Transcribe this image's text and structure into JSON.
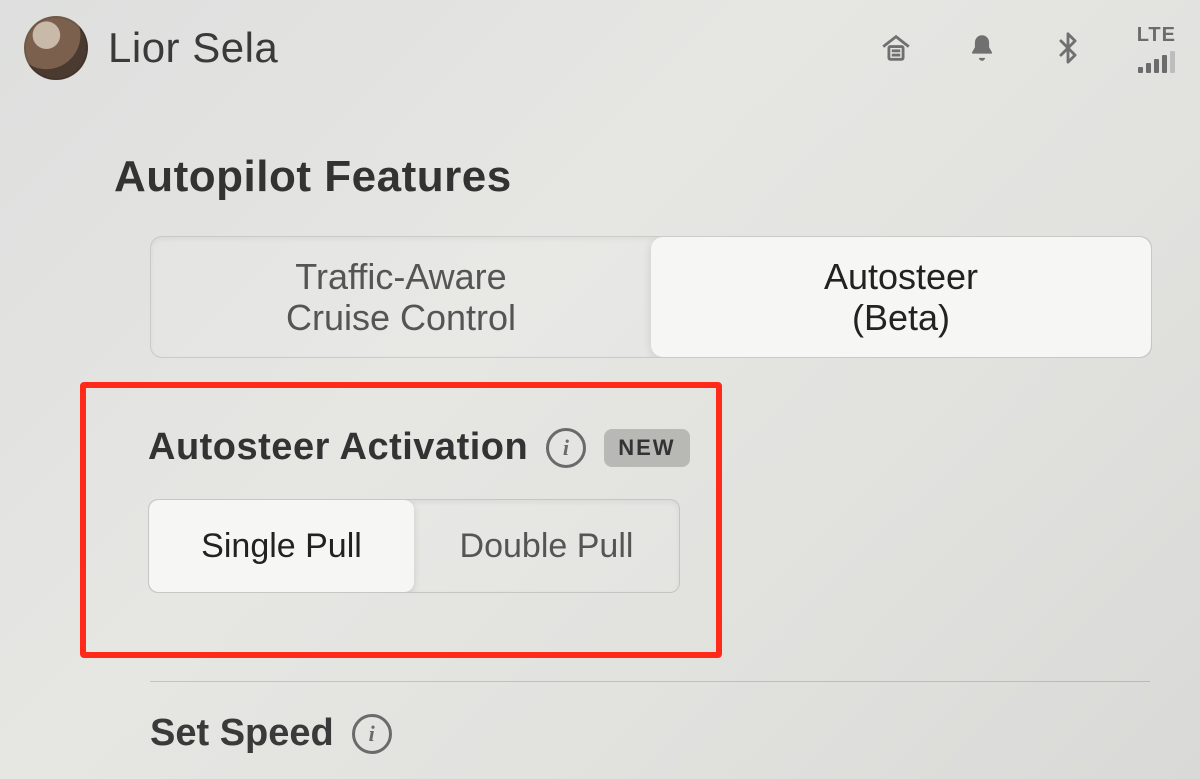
{
  "profile": {
    "name": "Lior Sela"
  },
  "status": {
    "signal_label": "LTE"
  },
  "section": {
    "title": "Autopilot Features"
  },
  "mode_toggle": {
    "option_a": "Traffic-Aware\nCruise Control",
    "option_b": "Autosteer\n(Beta)",
    "selected": "b"
  },
  "activation": {
    "heading": "Autosteer Activation",
    "badge": "NEW",
    "option_a": "Single Pull",
    "option_b": "Double Pull",
    "selected": "a"
  },
  "next_setting": {
    "heading": "Set Speed"
  }
}
